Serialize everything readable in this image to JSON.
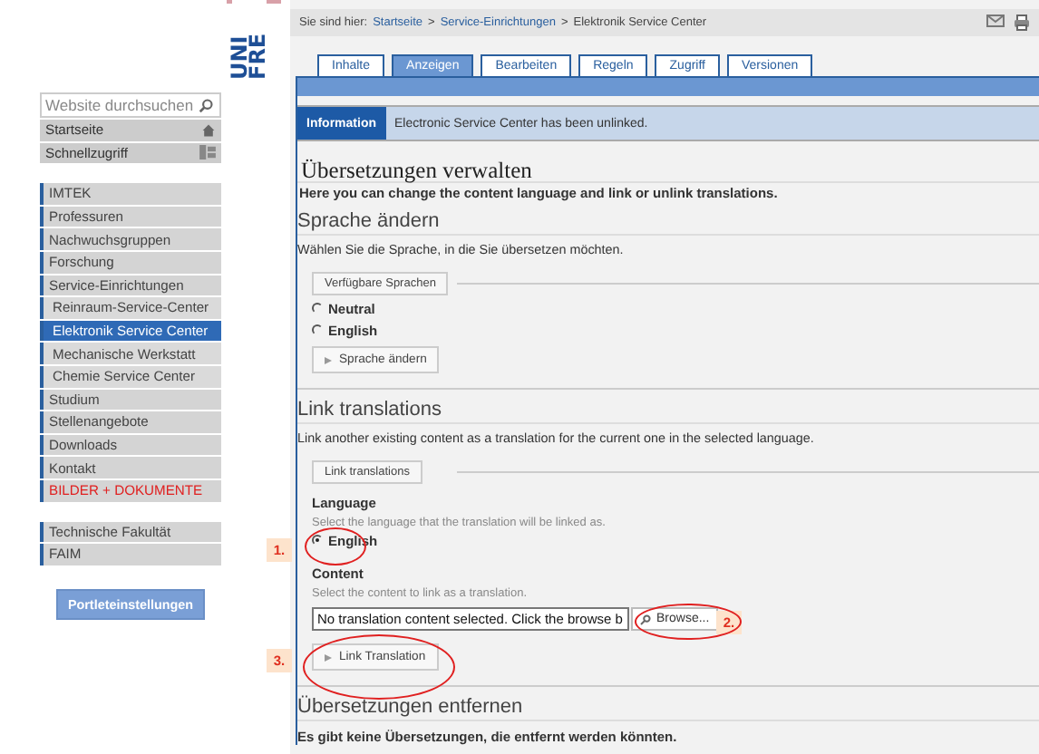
{
  "logo": {
    "lines": [
      "UNI",
      "FRE"
    ]
  },
  "sidebar": {
    "search": {
      "placeholder": "Website durchsuchen"
    },
    "quick_links": [
      {
        "label": "Startseite"
      },
      {
        "label": "Schnellzugriff"
      }
    ],
    "nav": [
      {
        "label": "IMTEK",
        "selected": false
      },
      {
        "label": "Professuren",
        "selected": false
      },
      {
        "label": "Nachwuchsgruppen",
        "selected": false
      },
      {
        "label": "Forschung",
        "selected": false
      },
      {
        "label": "Service-Einrichtungen",
        "selected": false,
        "children": [
          {
            "label": "Reinraum-Service-Center",
            "selected": false
          },
          {
            "label": "Elektronik Service Center",
            "selected": true
          },
          {
            "label": "Mechanische Werkstatt",
            "selected": false
          },
          {
            "label": "Chemie Service Center",
            "selected": false
          }
        ]
      },
      {
        "label": "Studium",
        "selected": false
      },
      {
        "label": "Stellenangebote",
        "selected": false
      },
      {
        "label": "Downloads",
        "selected": false
      },
      {
        "label": "Kontakt",
        "selected": false
      },
      {
        "label": "BILDER + DOKUMENTE",
        "selected": false,
        "highlight": true
      }
    ],
    "nav2": [
      {
        "label": "Technische Fakultät",
        "selected": false
      },
      {
        "label": "FAIM",
        "selected": false
      }
    ],
    "portlet_button": "Portleteinstellungen"
  },
  "breadcrumb": {
    "prefix": "Sie sind hier:",
    "items": [
      {
        "label": "Startseite",
        "link": true
      },
      {
        "label": "Service-Einrichtungen",
        "link": true
      },
      {
        "label": "Elektronik Service Center",
        "link": false
      }
    ],
    "separator": ">"
  },
  "tabs": [
    {
      "label": "Inhalte",
      "selected": false
    },
    {
      "label": "Anzeigen",
      "selected": true
    },
    {
      "label": "Bearbeiten",
      "selected": false
    },
    {
      "label": "Regeln",
      "selected": false
    },
    {
      "label": "Zugriff",
      "selected": false
    },
    {
      "label": "Versionen",
      "selected": false
    }
  ],
  "info": {
    "label": "Information",
    "message": "Electronic Service Center has been unlinked."
  },
  "title": "Übersetzungen verwalten",
  "intro": "Here you can change the content language and link or unlink translations.",
  "change_language": {
    "heading": "Sprache ändern",
    "description": "Wählen Sie die Sprache, in die Sie übersetzen möchten.",
    "legend": "Verfügbare Sprachen",
    "options": [
      {
        "label": "Neutral",
        "selected": false
      },
      {
        "label": "English",
        "selected": false
      }
    ],
    "button": "Sprache ändern"
  },
  "link_translations": {
    "heading": "Link translations",
    "description": "Link another existing content as a translation for the current one in the selected language.",
    "legend": "Link translations",
    "language_label": "Language",
    "language_hint": "Select the language that the translation will be linked as.",
    "options": [
      {
        "label": "English",
        "selected": true
      }
    ],
    "content_label": "Content",
    "content_hint": "Select the content to link as a translation.",
    "content_value": "No translation content selected. Click the browse b",
    "browse_button": "Browse...",
    "button": "Link Translation"
  },
  "remove": {
    "heading": "Übersetzungen entfernen",
    "message": "Es gibt keine Übersetzungen, die entfernt werden könnten."
  },
  "annotations": [
    {
      "label": "1."
    },
    {
      "label": "2."
    },
    {
      "label": "3."
    }
  ]
}
